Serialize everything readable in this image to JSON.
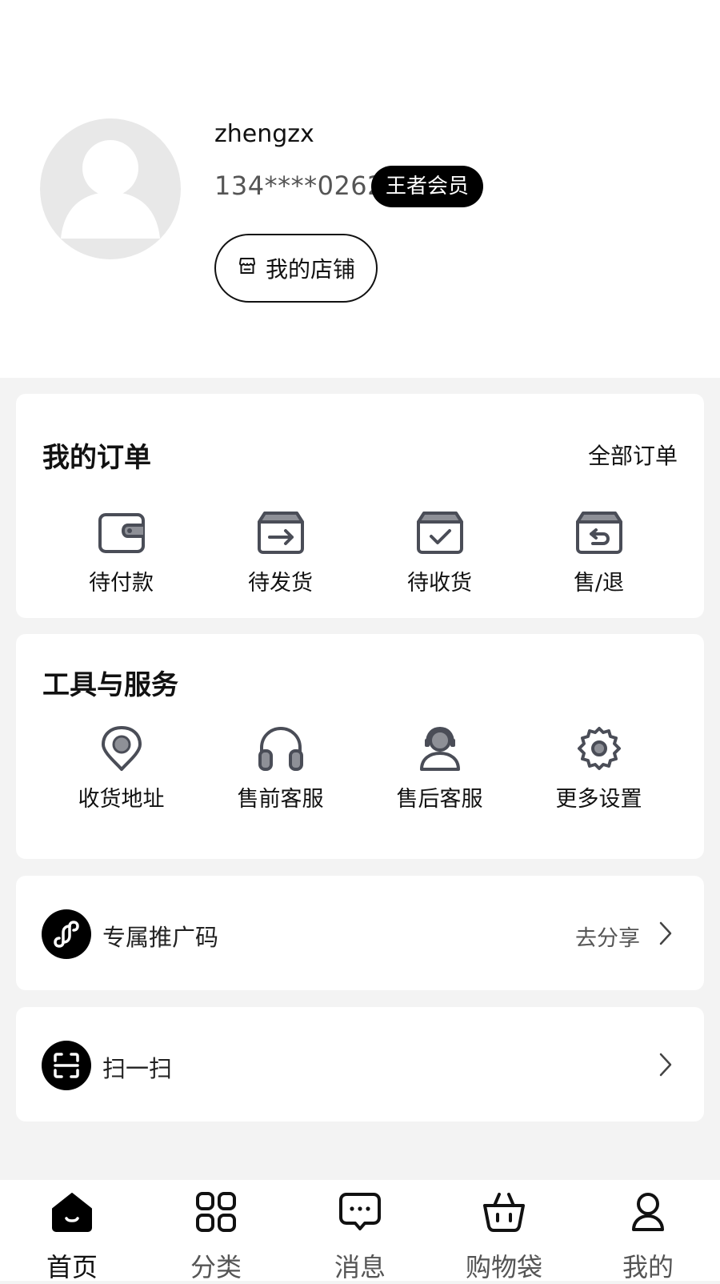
{
  "profile": {
    "username": "zhengzx",
    "phone": "134****0262",
    "member_badge": "王者会员",
    "shop_button": "我的店铺"
  },
  "orders": {
    "title": "我的订单",
    "all_link": "全部订单",
    "items": [
      {
        "label": "待付款",
        "icon": "wallet-icon"
      },
      {
        "label": "待发货",
        "icon": "box-arrow-icon"
      },
      {
        "label": "待收货",
        "icon": "box-check-icon"
      },
      {
        "label": "售/退",
        "icon": "box-return-icon"
      }
    ]
  },
  "tools": {
    "title": "工具与服务",
    "items": [
      {
        "label": "收货地址",
        "icon": "location-pin-icon"
      },
      {
        "label": "售前客服",
        "icon": "headphones-icon"
      },
      {
        "label": "售后客服",
        "icon": "agent-icon"
      },
      {
        "label": "更多设置",
        "icon": "gear-icon"
      }
    ]
  },
  "promo": {
    "label": "专属推广码",
    "action": "去分享"
  },
  "scan": {
    "label": "扫一扫"
  },
  "tabbar": {
    "items": [
      {
        "label": "首页",
        "icon": "home-icon",
        "active": true
      },
      {
        "label": "分类",
        "icon": "grid-icon",
        "active": false
      },
      {
        "label": "消息",
        "icon": "message-icon",
        "active": false
      },
      {
        "label": "购物袋",
        "icon": "basket-icon",
        "active": false
      },
      {
        "label": "我的",
        "icon": "user-icon",
        "active": false
      }
    ]
  },
  "colors": {
    "accent": "#000000",
    "icon_stroke": "#4a4d57",
    "icon_fill": "#8e9097",
    "page_bg": "#f3f3f3"
  }
}
